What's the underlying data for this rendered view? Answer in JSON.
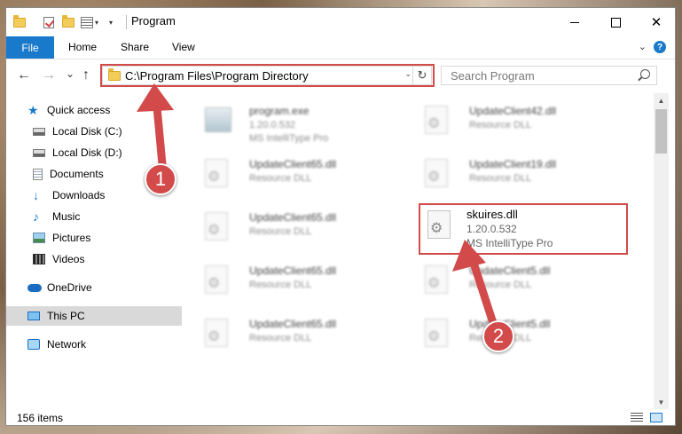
{
  "window": {
    "title": "Program",
    "close_glyph": "✕"
  },
  "ribbon": {
    "file": "File",
    "home": "Home",
    "share": "Share",
    "view": "View",
    "help": "?"
  },
  "nav": {
    "back": "←",
    "forward": "→",
    "recent": "⌄",
    "up": "↑",
    "address": "C:\\Program Files\\Program Directory",
    "search_placeholder": "Search Program"
  },
  "sidebar": {
    "items": [
      {
        "label": "Quick access",
        "icon": "star-icon"
      },
      {
        "label": "Local Disk (C:)",
        "icon": "disk-icon",
        "pinned": true
      },
      {
        "label": "Local Disk (D:)",
        "icon": "disk-icon",
        "pinned": true
      },
      {
        "label": "Documents",
        "icon": "documents-icon",
        "pinned": true
      },
      {
        "label": "Downloads",
        "icon": "downloads-icon",
        "pinned": true
      },
      {
        "label": "Music",
        "icon": "music-icon",
        "pinned": true
      },
      {
        "label": "Pictures",
        "icon": "pictures-icon",
        "pinned": true
      },
      {
        "label": "Videos",
        "icon": "videos-icon",
        "pinned": true
      },
      {
        "label": "OneDrive",
        "icon": "onedrive-icon"
      },
      {
        "label": "This PC",
        "icon": "pc-icon",
        "selected": true
      },
      {
        "label": "Network",
        "icon": "network-icon"
      }
    ]
  },
  "files": {
    "left": [
      {
        "name": "program.exe",
        "line2": "1.20.0.532",
        "line3": "MS IntelliType Pro"
      },
      {
        "name": "UpdateClient65.dll",
        "line2": "Resource DLL"
      },
      {
        "name": "UpdateClient65.dll",
        "line2": "Resource DLL"
      },
      {
        "name": "UpdateClient65.dll",
        "line2": "Resource DLL"
      },
      {
        "name": "UpdateClient65.dll",
        "line2": "Resource DLL"
      }
    ],
    "right": [
      {
        "name": "UpdateClient42.dll",
        "line2": "Resource DLL"
      },
      {
        "name": "UpdateClient19.dll",
        "line2": "Resource DLL"
      },
      {
        "name": "UpdateClient5.dll",
        "line2": "Resource DLL"
      },
      {
        "name": "UpdateClient5.dll",
        "line2": "Resource DLL"
      }
    ],
    "focus": {
      "name": "skuires.dll",
      "line2": "1.20.0.532",
      "line3": "MS IntelliType Pro"
    }
  },
  "status": {
    "count": "156 items"
  },
  "annotations": {
    "step1": "1",
    "step2": "2",
    "color": "#d24a4a"
  }
}
